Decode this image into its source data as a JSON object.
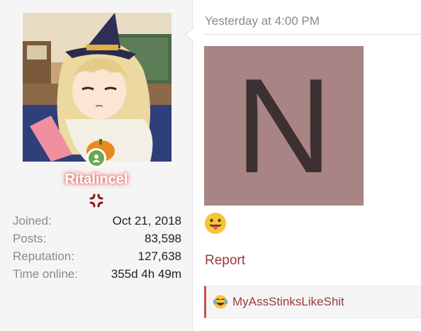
{
  "user": {
    "username": "Ritalincel",
    "avatar_icon": "anime-girl-witch-hat-avatar",
    "online_status_icon": "online-person-icon",
    "rank_icon": "angry-vein-icon",
    "stats": [
      {
        "label": "Joined:",
        "value": "Oct 21, 2018"
      },
      {
        "label": "Posts:",
        "value": "83,598"
      },
      {
        "label": "Reputation:",
        "value": "127,638"
      },
      {
        "label": "Time online:",
        "value": "355d 4h 49m"
      }
    ]
  },
  "post": {
    "timestamp": "Yesterday at 4:00 PM",
    "image_letter": "N",
    "image_bg_color": "#a88584",
    "emoji_icon": "tongue-out-emoji-icon",
    "report_label": "Report"
  },
  "reactions": {
    "emoji_icon": "laughing-tears-emoji-icon",
    "users": "MyAssStinksLikeShit"
  },
  "colors": {
    "link": "#9b3a3a",
    "username_glow": "#e06666",
    "online": "#6aa84f",
    "panel_bg": "#f5f5f5"
  }
}
